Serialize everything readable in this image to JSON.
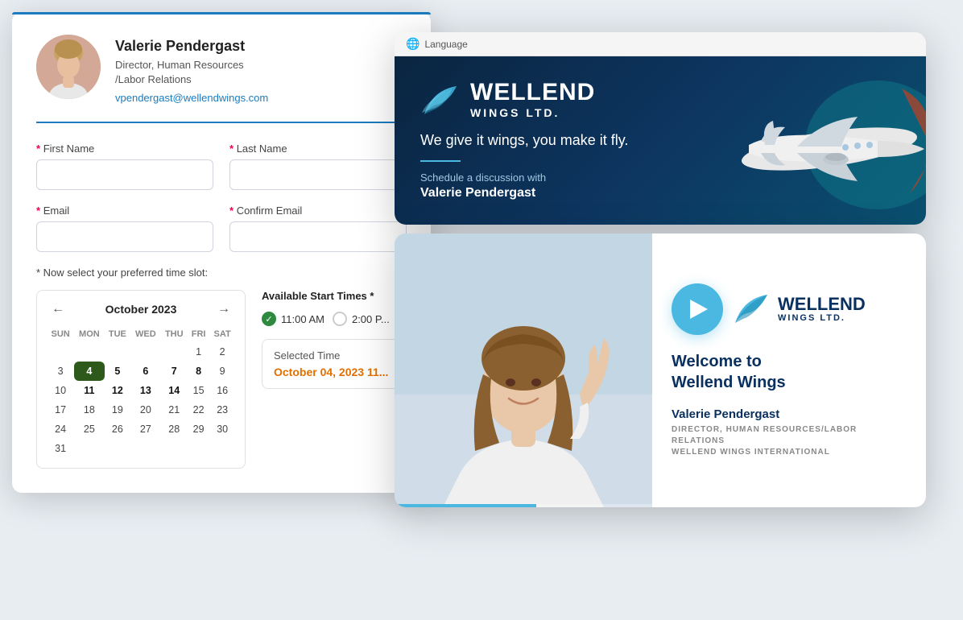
{
  "form_card": {
    "profile": {
      "name": "Valerie Pendergast",
      "title": "Director, Human Resources\n/Labor Relations",
      "email": "vpendergast@wellendwings.com"
    },
    "fields": {
      "first_name_label": "First Name",
      "last_name_label": "Last Name",
      "email_label": "Email",
      "confirm_email_label": "Confirm Email",
      "required_symbol": "*"
    },
    "time_slot_label": "* Now select your preferred time slot:",
    "calendar": {
      "month": "October 2023",
      "nav_prev": "←",
      "nav_next": "→",
      "days_header": [
        "SUN",
        "MON",
        "TUE",
        "WED",
        "THU",
        "FRI",
        "SAT"
      ],
      "selected_day": 4,
      "weeks": [
        [
          "",
          "",
          "",
          "",
          "",
          "1",
          "2"
        ],
        [
          "3",
          "4",
          "5",
          "6",
          "7",
          "8",
          "9"
        ],
        [
          "10",
          "11",
          "12",
          "13",
          "14",
          "15",
          "16"
        ],
        [
          "17",
          "18",
          "19",
          "20",
          "21",
          "22",
          "23"
        ],
        [
          "24",
          "25",
          "26",
          "27",
          "28",
          "29",
          "30"
        ],
        [
          "31",
          "",
          "",
          "",
          "",
          "",
          ""
        ]
      ]
    },
    "available_times": {
      "header": "Available Start Times *",
      "options": [
        {
          "time": "11:00 AM",
          "selected": true
        },
        {
          "time": "2:00 P...",
          "selected": false
        }
      ]
    },
    "selected_time": {
      "label": "Selected Time",
      "value": "October 04, 2023 11..."
    }
  },
  "landing_card": {
    "top_bar": {
      "language_label": "Language"
    },
    "hero": {
      "brand_name": "WELLEND",
      "brand_sub": "WINGS LTD.",
      "tagline": "We give it wings, you make it fly.",
      "schedule_prefix": "Schedule a discussion with",
      "schedule_name": "Valerie Pendergast"
    }
  },
  "video_card": {
    "brand_name": "WELLEND",
    "brand_sub": "WINGS LTD.",
    "video_title": "Welcome to\nWellend Wings",
    "person_name": "Valerie Pendergast",
    "person_role": "DIRECTOR, HUMAN RESOURCES/LABOR RELATIONS\nWELLEND WINGS INTERNATIONAL",
    "progress_percent": 55
  }
}
